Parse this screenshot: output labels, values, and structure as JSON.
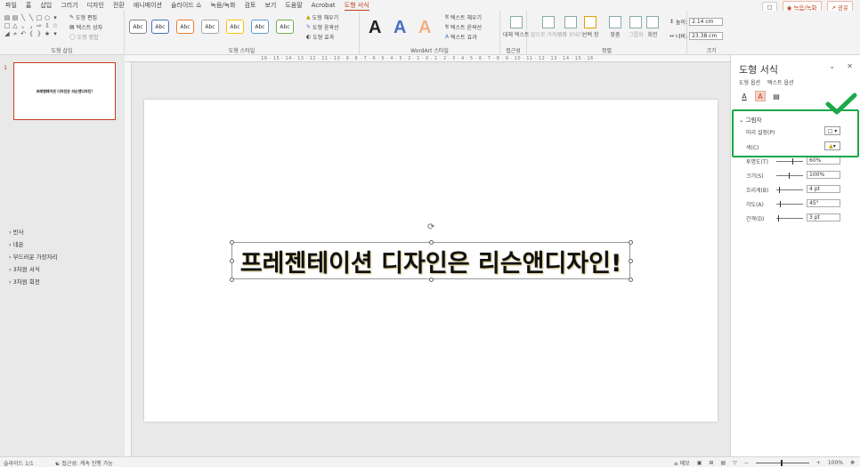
{
  "menu": {
    "tabs": [
      "파일",
      "홈",
      "삽입",
      "그리기",
      "디자인",
      "전환",
      "애니메이션",
      "슬라이드 쇼",
      "녹음/녹화",
      "검토",
      "보기",
      "도움말",
      "Acrobat",
      "도형 서식"
    ],
    "active_tab": "도형 서식",
    "comment_icon": "comment-icon",
    "record_label": "녹음/녹화",
    "share_label": "공유"
  },
  "ribbon": {
    "shape_insert": {
      "edit_shape": "도형 편집",
      "text_box": "텍스트 상자",
      "merge_shapes": "도형 병합",
      "label": "도형 삽입"
    },
    "shape_styles": {
      "swatch_label": "Abc",
      "fill": "도형 채우기",
      "outline": "도형 윤곽선",
      "effects": "도형 효과",
      "label": "도형 스타일"
    },
    "wordart": {
      "letter": "A",
      "text_fill": "텍스트 채우기",
      "text_outline": "텍스트 윤곽선",
      "text_effects": "텍스트 효과",
      "label": "WordArt 스타일"
    },
    "accessibility": {
      "alt_text": "대체 텍스트",
      "label": "접근성"
    },
    "arrange": {
      "forward": "앞으로 가져오기",
      "backward": "뒤로 보내기",
      "selection_pane": "선택 창",
      "align": "맞춤",
      "group": "그룹화",
      "rotate": "회전",
      "label": "정렬"
    },
    "size": {
      "height_label": "높이:",
      "height": "2.14 cm",
      "width_label": "너비:",
      "width": "23.38 cm",
      "label": "크기"
    }
  },
  "ruler": {
    "h_ticks": "· 16 · 15 · 14 · 13 · 12 · 11 · 10 · 9 · 8 · 7 · 6 · 5 · 4 · 3 · 2 · 1 · 0 · 1 · 2 · 3 · 4 · 5 · 6 · 7 · 8 · 9 · 10 · 11 · 12 · 13 · 14 · 15 · 16 ·"
  },
  "thumbnails": [
    {
      "number": "1",
      "text": "프레젠테이션 디자인은 리슨앤디자인!"
    }
  ],
  "slide": {
    "text": "프레젠테이션 디자인은 리슨앤디자인!"
  },
  "panel": {
    "title": "도형 서식",
    "tabs": [
      "도형 옵션",
      "텍스트 옵션"
    ],
    "shadow": {
      "heading": "그림자",
      "preset_label": "미리 설정(P)",
      "color_label": "색(C)",
      "transparency_label": "투명도(T)",
      "transparency": "60%",
      "size_label": "크기(S)",
      "size": "100%",
      "blur_label": "흐리게(B)",
      "blur": "4 pt",
      "angle_label": "각도(A)",
      "angle": "45°",
      "distance_label": "간격(D)",
      "distance": "3 pt"
    },
    "sections": [
      "반사",
      "네온",
      "부드러운 가장자리",
      "3차원 서식",
      "3차원 회전"
    ],
    "highlight_color": "#1aa84a"
  },
  "status": {
    "slide_info": "슬라이드 1/1",
    "accessibility": "접근성: 계속 진행 가능",
    "notes": "메모",
    "zoom": "100%"
  }
}
